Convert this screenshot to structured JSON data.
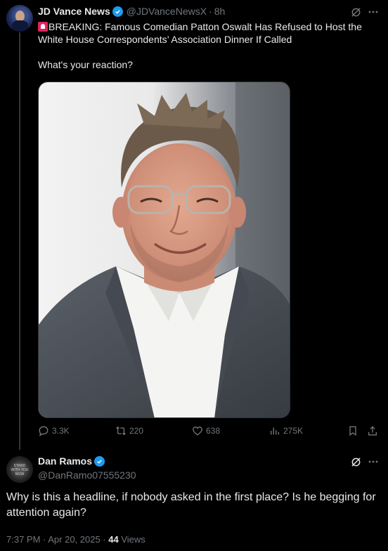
{
  "tweet": {
    "author_name": "JD Vance News",
    "handle": "@JDVanceNewsX",
    "time": "8h",
    "siren_icon": "rotating-light-emoji",
    "headline": "BREAKING: Famous Comedian Patton Oswalt Has Refused to Host the White House Correspondents’ Association Dinner If Called",
    "question": "What's your reaction?",
    "photo_alt": "Photo of Patton Oswalt smiling in a grey suit and white shirt",
    "stats": {
      "replies": "3.3K",
      "reposts": "220",
      "likes": "638",
      "views": "275K"
    }
  },
  "reply": {
    "author_name": "Dan Ramos",
    "handle": "@DanRamo07555230",
    "avatar_text": "STAND WITH YOU NOW",
    "text": "Why is this a headline, if nobody asked in the first place?  Is he begging for attention again?",
    "timestamp": "7:37 PM · Apr 20, 2025 · ",
    "views_count": "44",
    "views_label": "Views"
  },
  "colors": {
    "background": "#000000",
    "text": "#e7e9ea",
    "muted": "#71767b",
    "verified": "#1d9bf0"
  }
}
